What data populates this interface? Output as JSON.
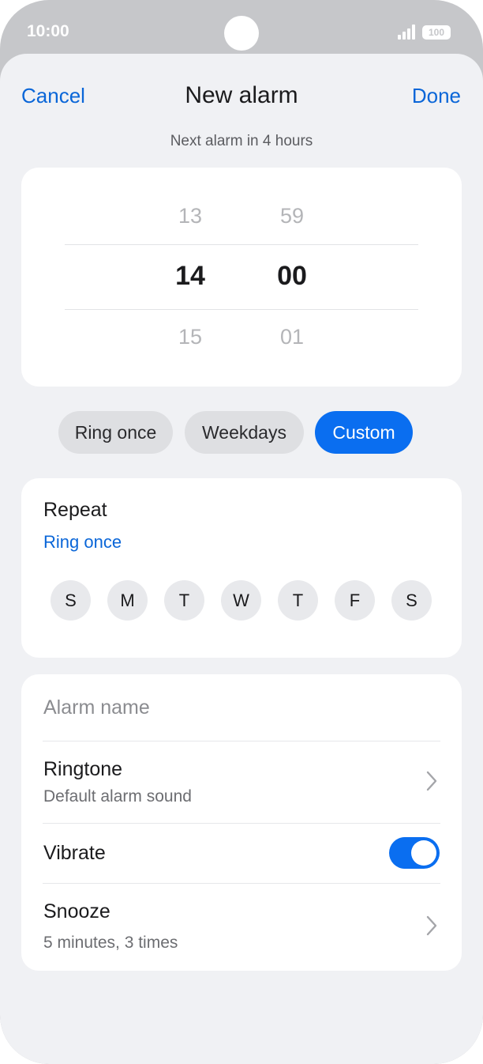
{
  "status": {
    "time": "10:00",
    "battery": "100"
  },
  "nav": {
    "cancel": "Cancel",
    "title": "New alarm",
    "done": "Done"
  },
  "subtitle": "Next alarm in 4 hours",
  "picker": {
    "hours": {
      "prev": "13",
      "selected": "14",
      "next": "15"
    },
    "minutes": {
      "prev": "59",
      "selected": "00",
      "next": "01"
    }
  },
  "chips": [
    {
      "label": "Ring once",
      "active": false
    },
    {
      "label": "Weekdays",
      "active": false
    },
    {
      "label": "Custom",
      "active": true
    }
  ],
  "repeat": {
    "title": "Repeat",
    "value": "Ring once",
    "days": [
      "S",
      "M",
      "T",
      "W",
      "T",
      "F",
      "S"
    ]
  },
  "settings": {
    "alarm_name_placeholder": "Alarm name",
    "ringtone": {
      "title": "Ringtone",
      "value": "Default alarm sound"
    },
    "vibrate": {
      "title": "Vibrate",
      "on": true
    },
    "snooze": {
      "title": "Snooze",
      "value": "5 minutes, 3 times"
    }
  },
  "colors": {
    "accent": "#0a6ef0",
    "link": "#0a66d8",
    "background": "#f0f1f4"
  }
}
